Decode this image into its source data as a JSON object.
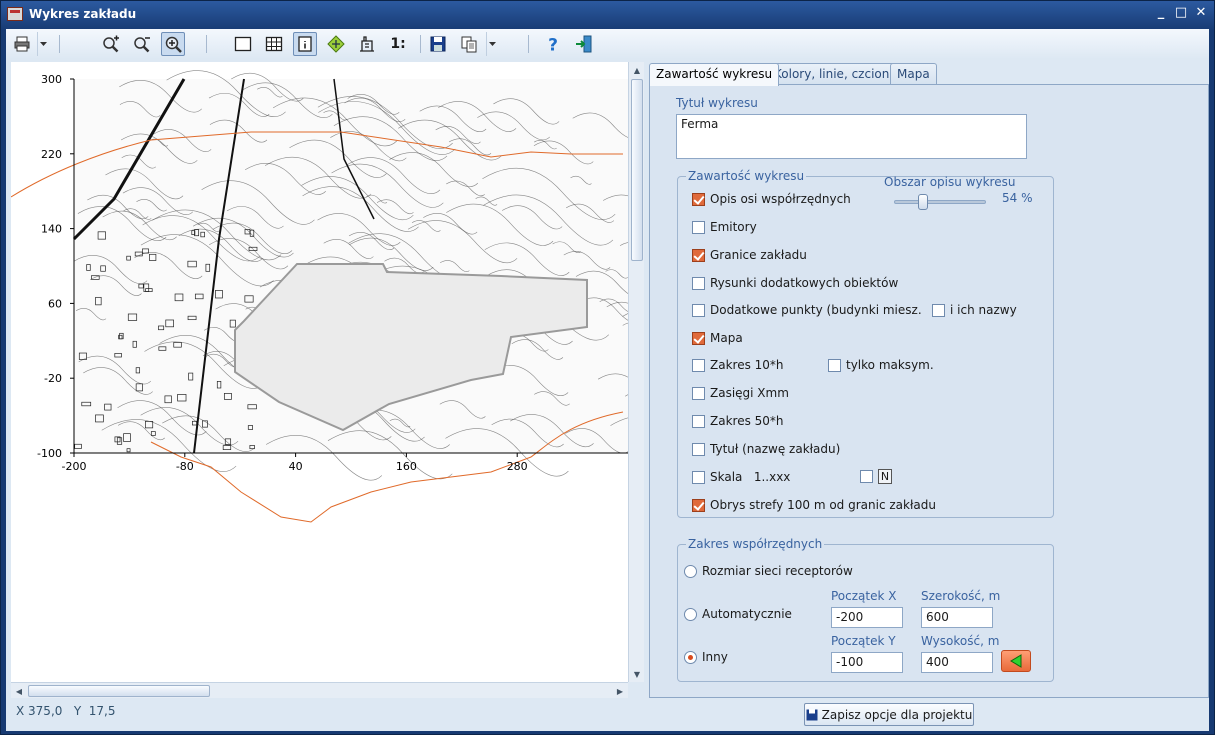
{
  "window": {
    "title": "Wykres zakładu",
    "controls": [
      "_",
      "□",
      "✕"
    ]
  },
  "toolbar": {
    "buttons": [
      {
        "name": "print-icon"
      },
      {
        "name": "zoom-in-icon"
      },
      {
        "name": "zoom-out-icon"
      },
      {
        "name": "zoom-fit-icon"
      },
      {
        "name": "frame-icon"
      },
      {
        "name": "grid-icon"
      },
      {
        "name": "info-icon"
      },
      {
        "name": "move-icon"
      },
      {
        "name": "building-icon"
      },
      {
        "name": "scale-icon",
        "label": "1:"
      },
      {
        "name": "save-icon"
      },
      {
        "name": "copy-icon"
      },
      {
        "name": "help-icon"
      },
      {
        "name": "exit-icon"
      }
    ]
  },
  "chart_data": {
    "type": "map",
    "x_ticks": [
      "-200",
      "-80",
      "40",
      "160",
      "280"
    ],
    "y_ticks": [
      "300",
      "220",
      "140",
      "60",
      "-20",
      "-100"
    ],
    "xlim": [
      -200,
      400
    ],
    "ylim": [
      -100,
      300
    ]
  },
  "status": {
    "coords": "X 375,0   Y  17,5"
  },
  "save_button": {
    "label": "Zapisz opcje dla projektu"
  },
  "tabs": [
    {
      "label": "Zawartość wykresu",
      "selected": true
    },
    {
      "label": "Kolory, linie, czcionki",
      "selected": false
    },
    {
      "label": "Mapa",
      "selected": false
    }
  ],
  "content": {
    "title_label": "Tytuł wykresu",
    "title_value": "Ferma",
    "group_label": "Zawartość wykresu",
    "area_label": "Obszar opisu wykresu",
    "area_value": "54 %",
    "area_fraction": 0.54,
    "checks": {
      "axes": {
        "label": "Opis osi współrzędnych",
        "checked": true
      },
      "emitters": {
        "label": "Emitory",
        "checked": false
      },
      "bounds": {
        "label": "Granice zakładu",
        "checked": true
      },
      "drawings": {
        "label": "Rysunki dodatkowych obiektów",
        "checked": false
      },
      "points": {
        "label": "Dodatkowe punkty (budynki miesz.",
        "checked": false
      },
      "names": {
        "label": "i ich nazwy",
        "checked": false
      },
      "map": {
        "label": "Mapa",
        "checked": true
      },
      "range10": {
        "label": "Zakres 10*h",
        "checked": false
      },
      "maxonly": {
        "label": "tylko maksym.",
        "checked": false
      },
      "xmm": {
        "label": "Zasięgi Xmm",
        "checked": false
      },
      "range50": {
        "label": "Zakres 50*h",
        "checked": false
      },
      "title": {
        "label": "Tytuł (nazwę zakładu)",
        "checked": false
      },
      "scale": {
        "label": "Skala   1..xxx",
        "checked": false
      },
      "north": {
        "label": "N",
        "checked": false
      },
      "zone": {
        "label": "Obrys strefy 100 m od granic zakładu",
        "checked": true
      }
    }
  },
  "coords": {
    "group_label": "Zakres współrzędnych",
    "radios": {
      "grid": {
        "label": "Rozmiar sieci receptorów",
        "selected": false
      },
      "auto": {
        "label": "Automatycznie",
        "selected": false
      },
      "other": {
        "label": "Inny",
        "selected": true
      }
    },
    "start_x_label": "Początek X",
    "start_x": "-200",
    "width_label": "Szerokość, m",
    "width": "600",
    "start_y_label": "Początek Y",
    "start_y": "-100",
    "height_label": "Wysokość, m",
    "height": "400"
  }
}
